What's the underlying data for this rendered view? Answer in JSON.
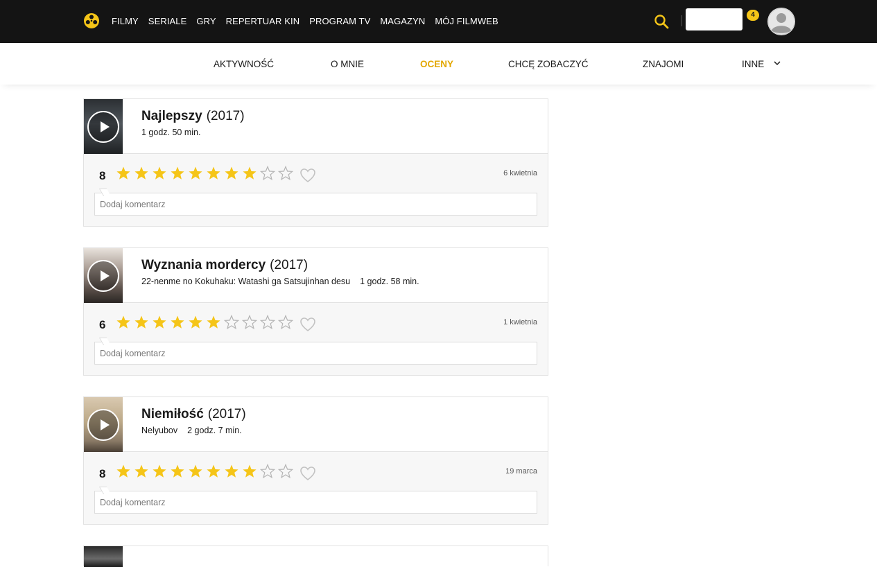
{
  "topnav": {
    "items": [
      "FILMY",
      "SERIALE",
      "GRY",
      "REPERTUAR KIN",
      "PROGRAM TV",
      "MAGAZYN",
      "MÓJ FILMWEB"
    ],
    "notification_count": "4"
  },
  "subnav": {
    "tabs": [
      "AKTYWNOŚĆ",
      "O MNIE",
      "OCENY",
      "CHCĘ ZOBACZYĆ",
      "ZNAJOMI",
      "INNE"
    ],
    "active": "OCENY"
  },
  "colors": {
    "accent": "#f5c518",
    "active_tab": "#e3a700",
    "topbar": "#141414"
  },
  "ratings": [
    {
      "title": "Najlepszy",
      "year": "(2017)",
      "original_title": "",
      "duration": "1 godz. 50 min.",
      "score": "8",
      "date": "6 kwietnia",
      "comment_placeholder": "Dodaj komentarz"
    },
    {
      "title": "Wyznania mordercy",
      "year": "(2017)",
      "original_title": "22-nenme no Kokuhaku: Watashi ga Satsujinhan desu",
      "duration": "1 godz. 58 min.",
      "score": "6",
      "date": "1 kwietnia",
      "comment_placeholder": "Dodaj komentarz"
    },
    {
      "title": "Niemiłość",
      "year": "(2017)",
      "original_title": "Nelyubov",
      "duration": "2 godz. 7 min.",
      "score": "8",
      "date": "19 marca",
      "comment_placeholder": "Dodaj komentarz"
    }
  ]
}
